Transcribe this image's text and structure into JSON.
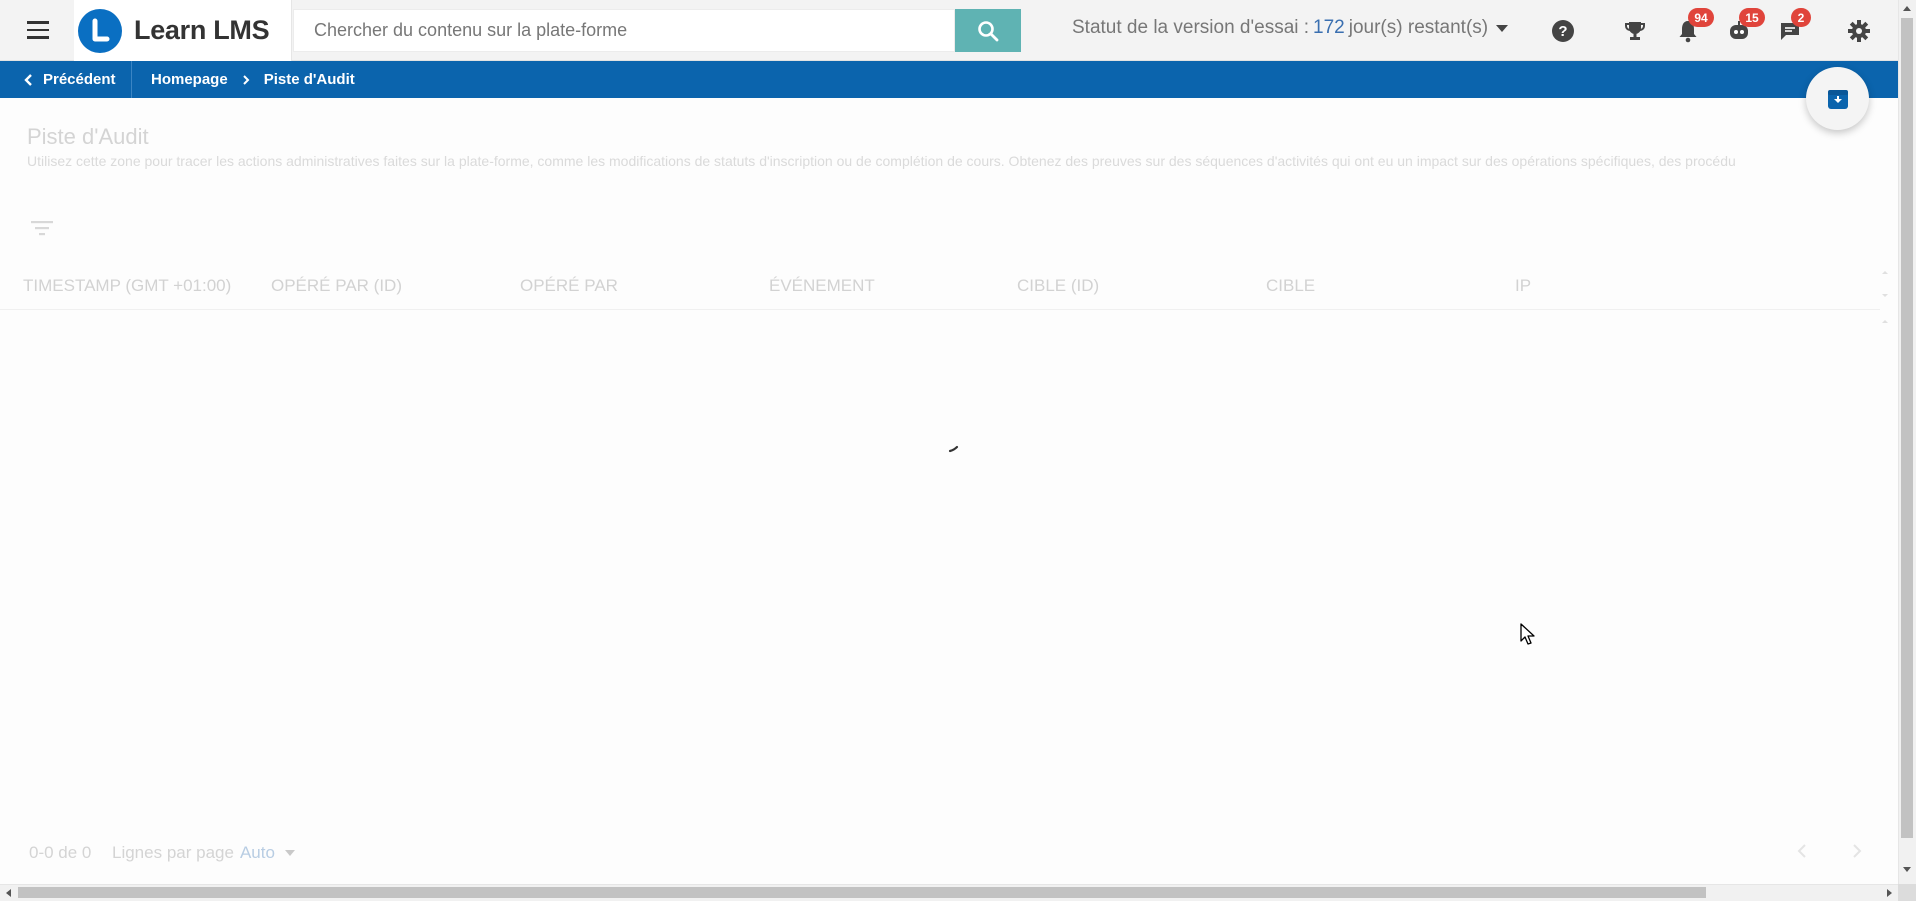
{
  "header": {
    "brand": "Learn LMS",
    "search_placeholder": "Chercher du contenu sur la plate-forme",
    "trial_prefix": "Statut de la version d'essai :",
    "trial_days": "172",
    "trial_suffix": "jour(s) restant(s)",
    "badges": {
      "notifications": "94",
      "messages_bot": "15",
      "chat": "2"
    }
  },
  "breadcrumb": {
    "back_label": "Précédent",
    "items": [
      "Homepage",
      "Piste d'Audit"
    ]
  },
  "page": {
    "title": "Piste d'Audit",
    "description": "Utilisez cette zone pour tracer les actions administratives faites sur la plate-forme, comme les modifications de statuts d'inscription ou de complétion de cours. Obtenez des preuves sur des séquences d'activités qui ont eu un impact sur des opérations spécifiques, des procédu"
  },
  "table": {
    "columns": [
      "TIMESTAMP (GMT +01:00)",
      "OPÉRÉ PAR (ID)",
      "OPÉRÉ PAR",
      "ÉVÉNEMENT",
      "CIBLE (ID)",
      "CIBLE",
      "IP"
    ]
  },
  "footer": {
    "range": "0-0 de 0",
    "rows_per_page_label": "Lignes par page",
    "rows_per_page_value": "Auto"
  },
  "colors": {
    "brand_blue": "#0b64ad",
    "search_button": "#5fb3b3",
    "badge_red": "#e0443b"
  }
}
